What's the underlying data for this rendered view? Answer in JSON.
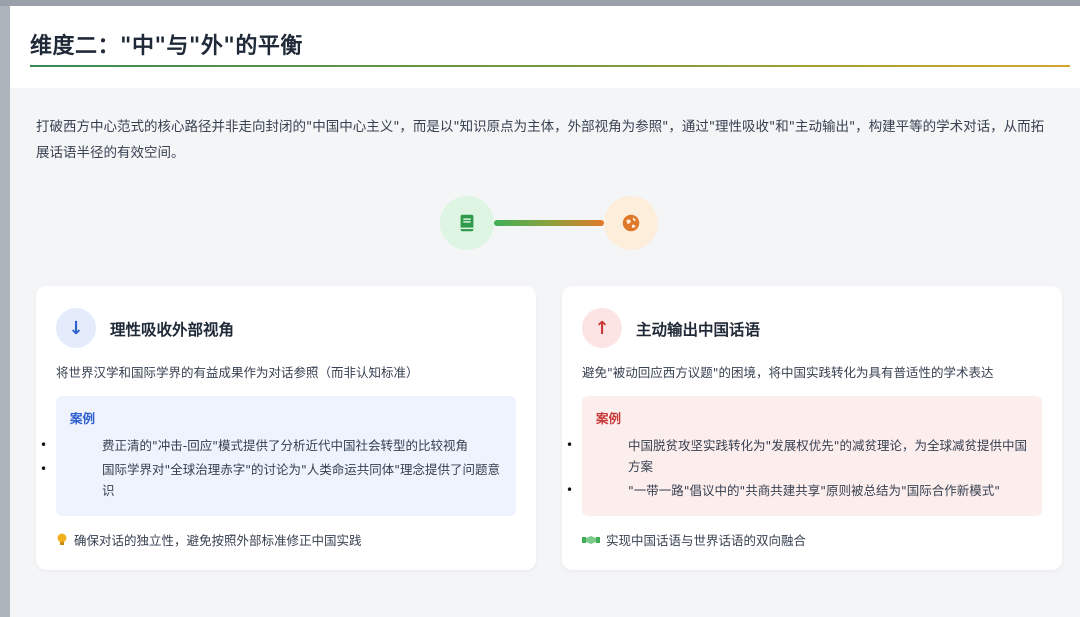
{
  "header": {
    "title": "维度二：\"中\"与\"外\"的平衡"
  },
  "intro": {
    "text": "打破西方中心范式的核心路径并非走向封闭的\"中国中心主义\"，而是以\"知识原点为主体，外部视角为参照\"，通过\"理性吸收\"和\"主动输出\"，构建平等的学术对话，从而拓展话语半径的有效空间。"
  },
  "connector": {
    "left_icon": "book-icon",
    "right_icon": "globe-icon",
    "colors": {
      "left": "#3fae57",
      "right": "#e0782a"
    }
  },
  "cards": {
    "left": {
      "icon": "arrow-down-icon",
      "icon_glyph": "↓",
      "title": "理性吸收外部视角",
      "desc": "将世界汉学和国际学界的有益成果作为对话参照（而非认知标准）",
      "case_label": "案例",
      "cases": [
        "费正清的\"冲击-回应\"模式提供了分析近代中国社会转型的比较视角",
        "国际学界对\"全球治理赤字\"的讨论为\"人类命运共同体\"理念提供了问题意识"
      ],
      "foot_icon": "lightbulb-icon",
      "foot": "确保对话的独立性，避免按照外部标准修正中国实践",
      "accent": "#2f5fd0"
    },
    "right": {
      "icon": "arrow-up-icon",
      "icon_glyph": "↑",
      "title": "主动输出中国话语",
      "desc": "避免\"被动回应西方议题\"的困境，将中国实践转化为具有普适性的学术表达",
      "case_label": "案例",
      "cases": [
        "中国脱贫攻坚实践转化为\"发展权优先\"的减贫理论，为全球减贫提供中国方案",
        "\"一带一路\"倡议中的\"共商共建共享\"原则被总结为\"国际合作新模式\""
      ],
      "foot_icon": "handshake-icon",
      "foot": "实现中国话语与世界话语的双向融合",
      "accent": "#c83a3a"
    }
  },
  "bullet": "•"
}
